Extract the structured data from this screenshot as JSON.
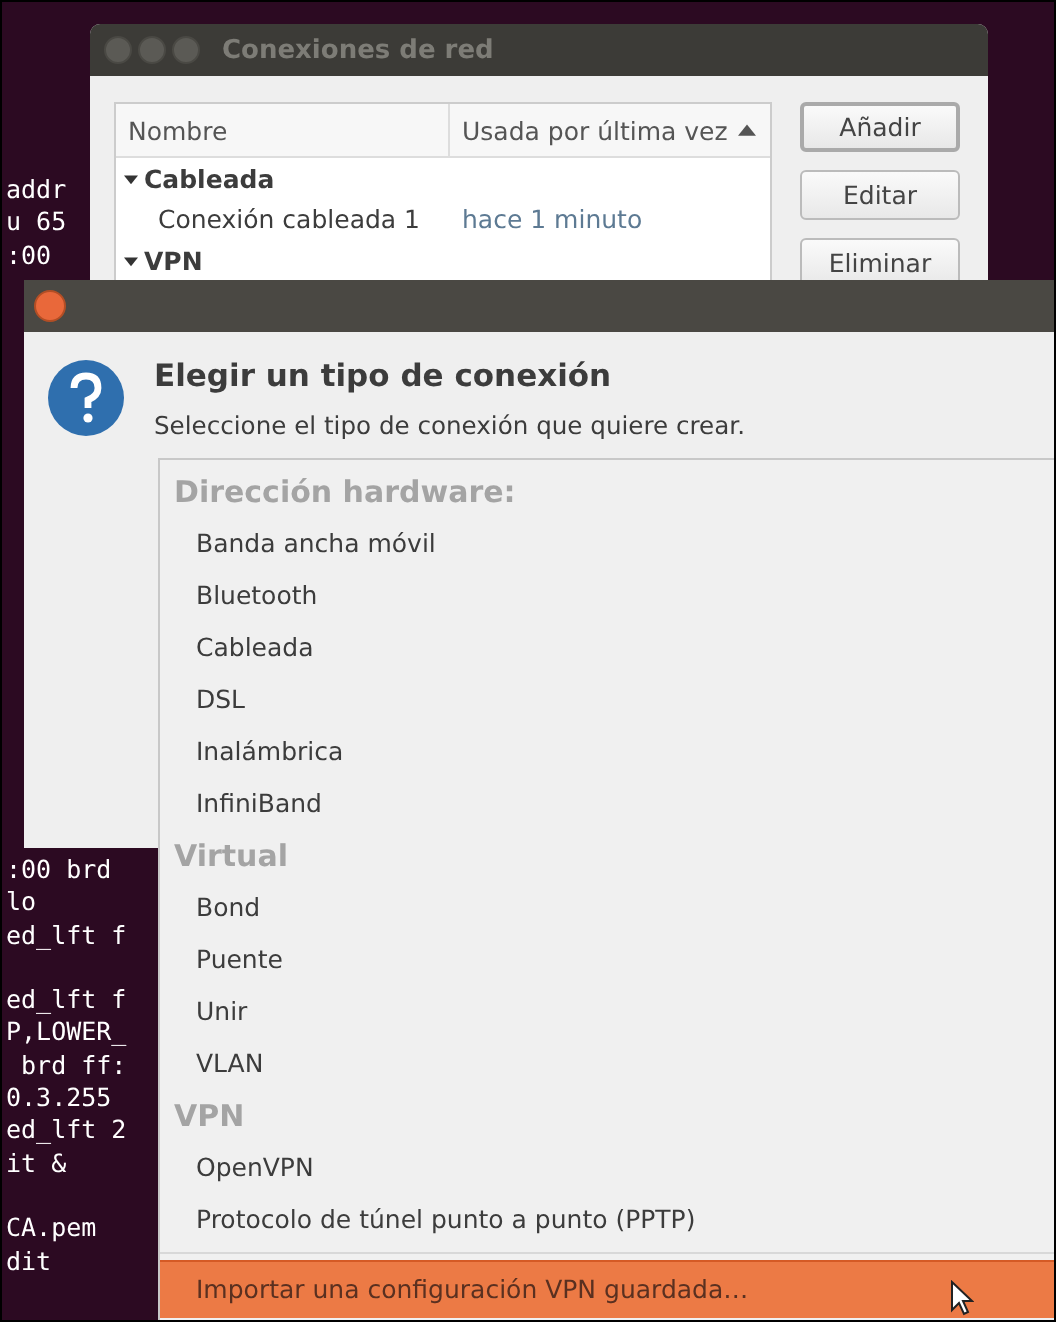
{
  "terminal": {
    "upper_lines": [
      "addr",
      "u 65",
      ":00"
    ],
    "lower_blocks": [
      [
        ":00 brd",
        "lo",
        "ed_lft f"
      ],
      [
        "ed_lft f",
        "P,LOWER_",
        " brd ff:",
        "0.3.255",
        "ed_lft 2",
        "it &"
      ],
      [
        "CA.pem",
        "dit"
      ]
    ]
  },
  "back_window": {
    "title": "Conexiones de red",
    "columns": [
      {
        "label": "Nombre",
        "sorted": false
      },
      {
        "label": "Usada por última vez",
        "sorted": true
      }
    ],
    "groups": [
      {
        "name": "Cableada",
        "expanded": true,
        "rows": [
          {
            "name": "Conexión cableada 1",
            "last_used": "hace 1 minuto"
          }
        ]
      },
      {
        "name": "VPN",
        "expanded": true
      }
    ],
    "buttons": [
      {
        "label": "Añadir",
        "focused": true
      },
      {
        "label": "Editar",
        "focused": false
      },
      {
        "label": "Eliminar",
        "focused": false
      }
    ]
  },
  "dialog": {
    "title": "Elegir un tipo de conexión",
    "subtitle": "Seleccione el tipo de conexión que quiere crear.",
    "menu": [
      {
        "kind": "header",
        "label": "Dirección hardware:"
      },
      {
        "kind": "item",
        "label": "Banda ancha móvil",
        "selected": false
      },
      {
        "kind": "item",
        "label": "Bluetooth",
        "selected": false
      },
      {
        "kind": "item",
        "label": "Cableada",
        "selected": false
      },
      {
        "kind": "item",
        "label": "DSL",
        "selected": false
      },
      {
        "kind": "item",
        "label": "Inalámbrica",
        "selected": false
      },
      {
        "kind": "item",
        "label": "InfiniBand",
        "selected": false
      },
      {
        "kind": "header",
        "label": "Virtual"
      },
      {
        "kind": "item",
        "label": "Bond",
        "selected": false
      },
      {
        "kind": "item",
        "label": "Puente",
        "selected": false
      },
      {
        "kind": "item",
        "label": "Unir",
        "selected": false
      },
      {
        "kind": "item",
        "label": "VLAN",
        "selected": false
      },
      {
        "kind": "header",
        "label": "VPN"
      },
      {
        "kind": "item",
        "label": "OpenVPN",
        "selected": false
      },
      {
        "kind": "item",
        "label": "Protocolo de túnel punto a punto (PPTP)",
        "selected": false
      },
      {
        "kind": "separator"
      },
      {
        "kind": "item",
        "label": "Importar una configuración VPN guardada…",
        "selected": true
      }
    ]
  }
}
